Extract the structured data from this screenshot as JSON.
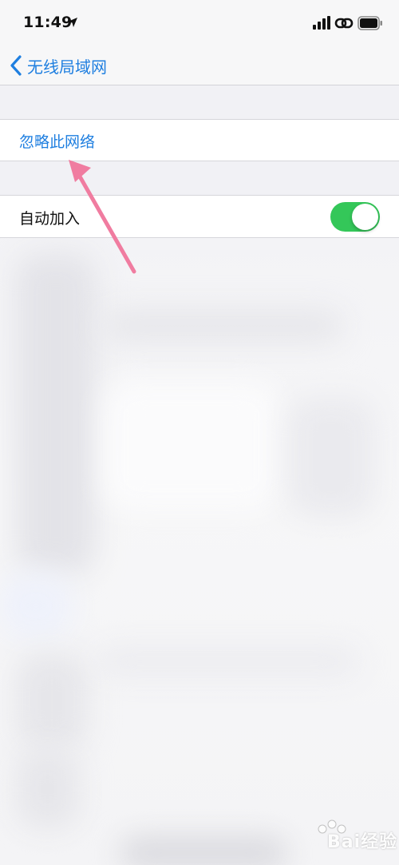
{
  "status_bar": {
    "time": "11:49",
    "icons": [
      "location-arrow-icon",
      "signal-icon",
      "link-icon",
      "battery-icon"
    ]
  },
  "nav": {
    "back_label": "无线局域网",
    "back_icon": "chevron-left-icon"
  },
  "forget_network": {
    "label": "忽略此网络"
  },
  "auto_join": {
    "label": "自动加入",
    "enabled": true
  },
  "colors": {
    "accent": "#1f7fe0",
    "toggle_on": "#34c759",
    "annotation_arrow": "#f07ca0"
  },
  "watermark": {
    "text": "Bai经验"
  }
}
